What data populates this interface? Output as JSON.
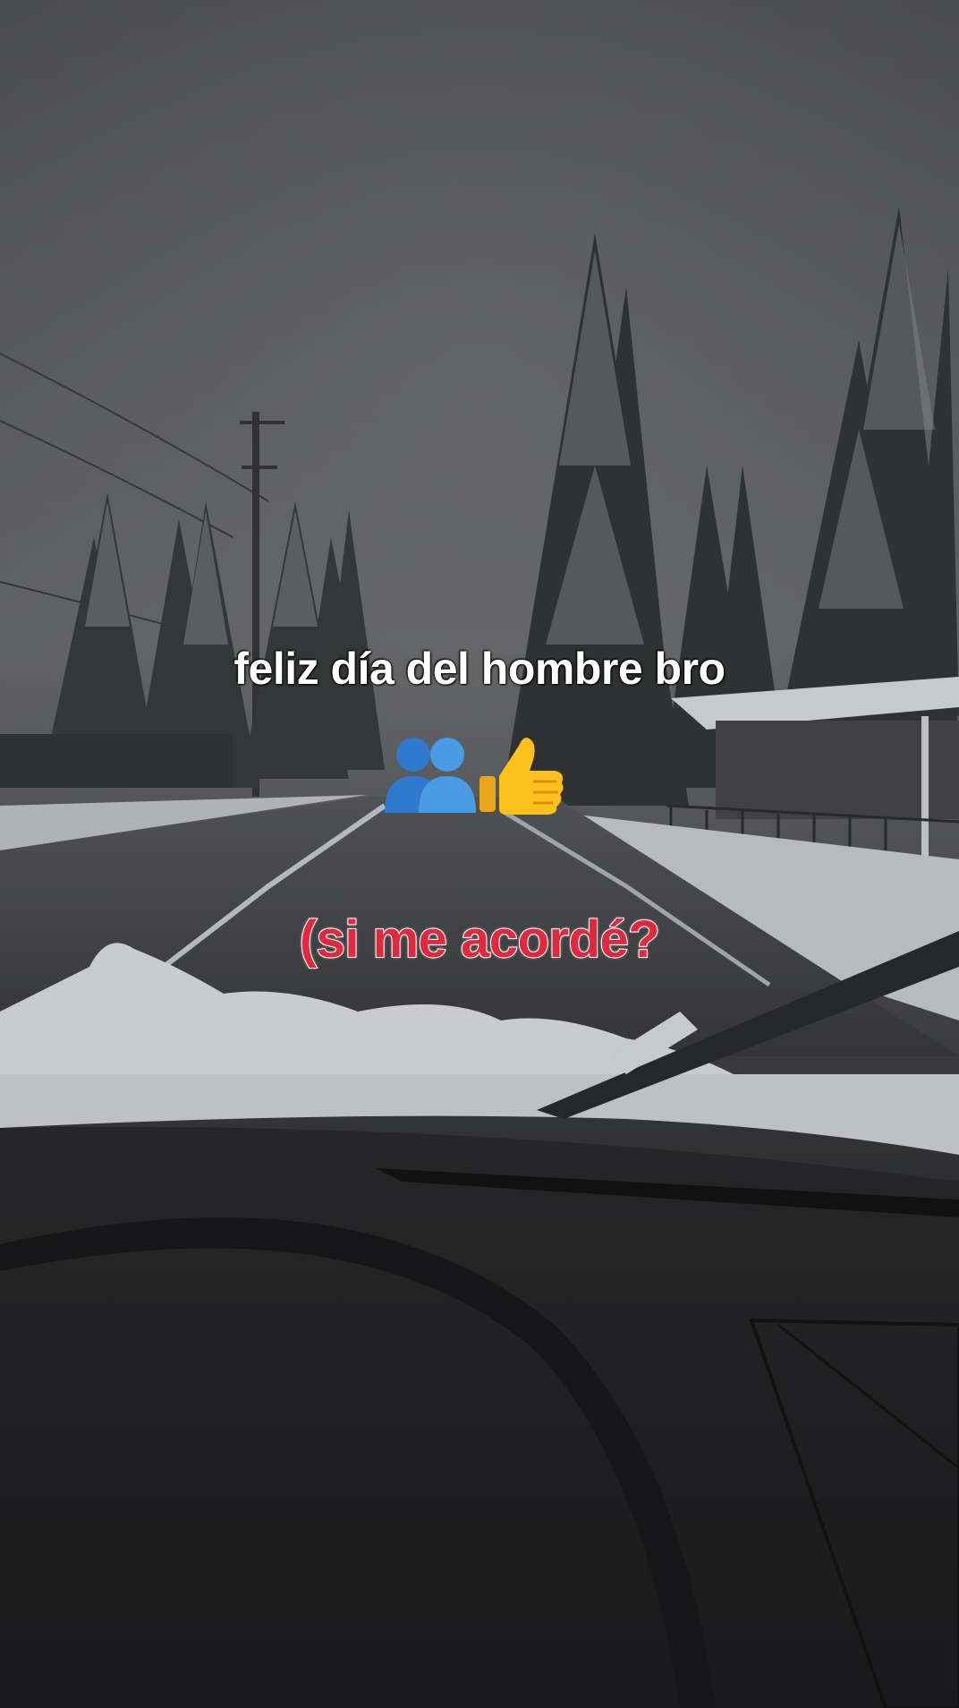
{
  "captions": {
    "line1": "feliz día del hombre bro",
    "line2": "(si me acordé?",
    "emojis": [
      "people-silhouettes-emoji",
      "thumbs-up-emoji"
    ]
  },
  "colors": {
    "caption_white": "#ffffff",
    "caption_red": "#e0293f",
    "sky": "#6e6f72",
    "snow": "#e9ebee",
    "dashboard": "#242426"
  }
}
